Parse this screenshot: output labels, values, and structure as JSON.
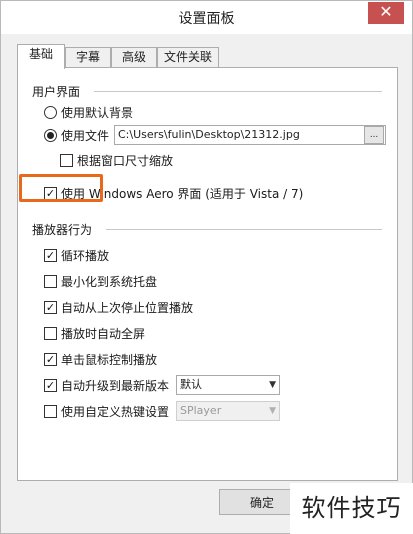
{
  "window": {
    "title": "设置面板",
    "close_glyph": "✕"
  },
  "tabs": [
    {
      "label": "基础",
      "active": true
    },
    {
      "label": "字幕",
      "active": false
    },
    {
      "label": "高级",
      "active": false
    },
    {
      "label": "文件关联",
      "active": false
    }
  ],
  "ui_group": {
    "label": "用户界面",
    "default_bg_label": "使用默认背景",
    "use_file_label": "使用文件",
    "file_path": "C:\\Users\\fulin\\Desktop\\21312.jpg",
    "browse_label": "...",
    "scale_label": "根据窗口尺寸缩放",
    "aero_label": "使用 Windows Aero 界面 (适用于 Vista / 7)"
  },
  "player_group": {
    "label": "播放器行为",
    "loop_label": "循环播放",
    "tray_label": "最小化到系统托盘",
    "resume_label": "自动从上次停止位置播放",
    "fullscreen_label": "播放时自动全屏",
    "click_label": "单击鼠标控制播放",
    "upgrade_label": "自动升级到最新版本",
    "upgrade_value": "默认",
    "hotkey_label": "使用自定义热键设置",
    "hotkey_value": "SPlayer"
  },
  "check_glyph": "✓",
  "ok_label": "确定",
  "watermark_text": "软件技巧",
  "colors": {
    "highlight": "#e8691c",
    "close": "#c75050"
  }
}
